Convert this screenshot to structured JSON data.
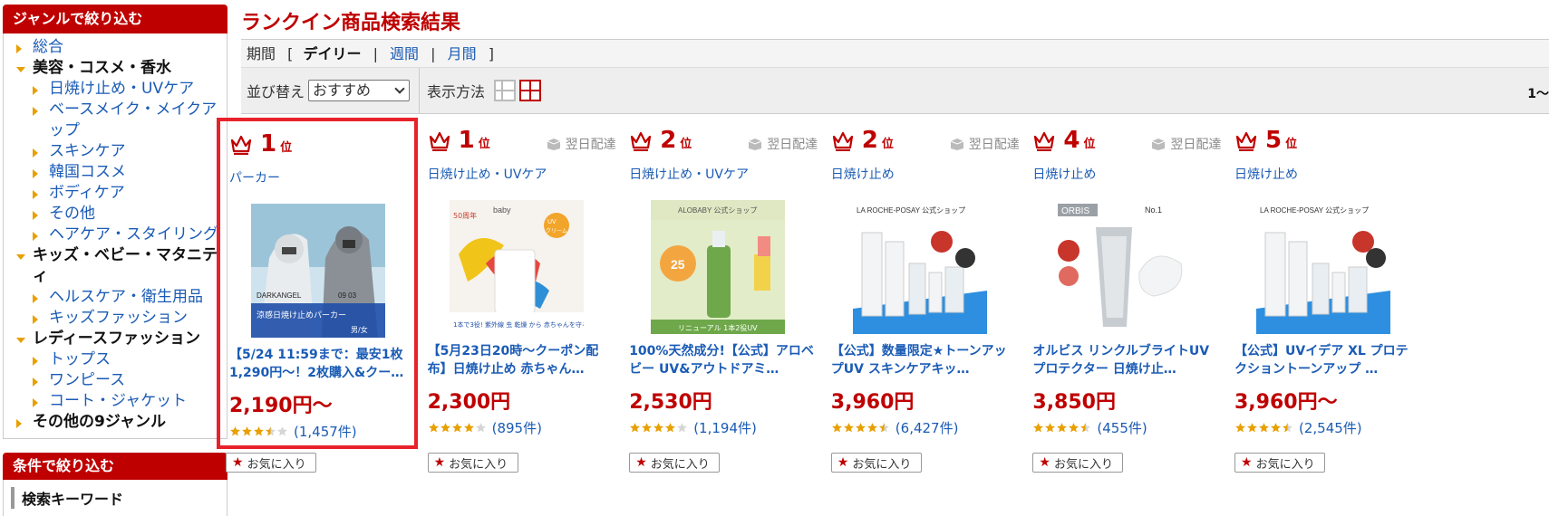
{
  "sidebar": {
    "genre_title": "ジャンルで絞り込む",
    "items": [
      {
        "label": "総合",
        "level": "top",
        "arrow": "right",
        "style": "link"
      },
      {
        "label": "美容・コスメ・香水",
        "level": "top",
        "arrow": "down",
        "style": "bold"
      },
      {
        "label": "日焼け止め・UVケア",
        "level": "sub",
        "arrow": "right",
        "style": "link"
      },
      {
        "label": "ベースメイク・メイクアップ",
        "level": "sub",
        "arrow": "right",
        "style": "link"
      },
      {
        "label": "スキンケア",
        "level": "sub",
        "arrow": "right",
        "style": "link"
      },
      {
        "label": "韓国コスメ",
        "level": "sub",
        "arrow": "right",
        "style": "link"
      },
      {
        "label": "ボディケア",
        "level": "sub",
        "arrow": "right",
        "style": "link"
      },
      {
        "label": "その他",
        "level": "sub",
        "arrow": "right",
        "style": "link"
      },
      {
        "label": "ヘアケア・スタイリング",
        "level": "sub",
        "arrow": "right",
        "style": "link"
      },
      {
        "label": "キッズ・ベビー・マタニティ",
        "level": "top",
        "arrow": "down",
        "style": "bold"
      },
      {
        "label": "ヘルスケア・衛生用品",
        "level": "sub",
        "arrow": "right",
        "style": "link"
      },
      {
        "label": "キッズファッション",
        "level": "sub",
        "arrow": "right",
        "style": "link"
      },
      {
        "label": "レディースファッション",
        "level": "top",
        "arrow": "down",
        "style": "bold"
      },
      {
        "label": "トップス",
        "level": "sub",
        "arrow": "right",
        "style": "link"
      },
      {
        "label": "ワンピース",
        "level": "sub",
        "arrow": "right",
        "style": "link"
      },
      {
        "label": "コート・ジャケット",
        "level": "sub",
        "arrow": "right",
        "style": "link"
      },
      {
        "label": "その他の9ジャンル",
        "level": "top",
        "arrow": "right",
        "style": "bold"
      }
    ],
    "condition_title": "条件で絞り込む",
    "keyword_label": "検索キーワード"
  },
  "main": {
    "title": "ランクイン商品検索結果",
    "period_label": "期間",
    "bracket_open": "[",
    "bracket_close": "]",
    "sep": "|",
    "period_active": "デイリー",
    "period_weekly": "週間",
    "period_monthly": "月間",
    "sort_label": "並び替え",
    "sort_value": "おすすめ",
    "view_label": "表示方法",
    "count_text": "1〜"
  },
  "colors": {
    "accent": "#bf0000",
    "link": "#1a5bb5",
    "star": "#e8a000",
    "highlight": "#e8222b"
  },
  "products": [
    {
      "rank": "1",
      "rank_unit": "位",
      "genre": "パーカー",
      "delivery": "",
      "title": "【5/24 11:59まで：最安1枚1,290円〜！2枚購入&クー…",
      "price": "2,190円〜",
      "rating": 3.5,
      "reviews": "(1,457件)",
      "fav": "お気に入り",
      "image": "parka"
    },
    {
      "rank": "1",
      "rank_unit": "位",
      "genre": "日焼け止め・UVケア",
      "delivery": "翌日配達",
      "title": "【5月23日20時〜クーポン配布】日焼け止め 赤ちゃん…",
      "price": "2,300円",
      "rating": 4.0,
      "reviews": "(895件)",
      "fav": "お気に入り",
      "image": "baby"
    },
    {
      "rank": "2",
      "rank_unit": "位",
      "genre": "日焼け止め・UVケア",
      "delivery": "翌日配達",
      "title": "100%天然成分!【公式】アロベビー UV&アウトドアミ…",
      "price": "2,530円",
      "rating": 4.0,
      "reviews": "(1,194件)",
      "fav": "お気に入り",
      "image": "alobaby"
    },
    {
      "rank": "2",
      "rank_unit": "位",
      "genre": "日焼け止め",
      "delivery": "翌日配達",
      "title": "【公式】数量限定★トーンアップUV スキンケアキッ…",
      "price": "3,960円",
      "rating": 4.5,
      "reviews": "(6,427件)",
      "fav": "お気に入り",
      "image": "laroche"
    },
    {
      "rank": "4",
      "rank_unit": "位",
      "genre": "日焼け止め",
      "delivery": "翌日配達",
      "title": "オルビス リンクルブライトUVプロテクター 日焼け止…",
      "price": "3,850円",
      "rating": 4.5,
      "reviews": "(455件)",
      "fav": "お気に入り",
      "image": "orbis"
    },
    {
      "rank": "5",
      "rank_unit": "位",
      "genre": "日焼け止め",
      "delivery": "",
      "title": "【公式】UVイデア XL プロテクショントーンアップ …",
      "price": "3,960円〜",
      "rating": 4.5,
      "reviews": "(2,545件)",
      "fav": "お気に入り",
      "image": "laroche2"
    }
  ],
  "thumb_text": {
    "parka_brand": "DARKANGEL",
    "parka_date": "09 03",
    "parka_banner": "涼感日焼け止めパーカー",
    "parka_tags": "男/女",
    "baby_brand": "baby",
    "baby_50": "50周年",
    "baby_uv": "UV",
    "baby_cream": "クリーム",
    "baby_banner": "1本で3役! 紫外線 虫 乾燥 から 赤ちゃんを守る",
    "alobaby_brand": "ALOBABY 公式ショップ",
    "alobaby_badge": "25",
    "alobaby_foot": "リニューアル 1本2役UV",
    "laroche_brand": "LA ROCHE-POSAY 公式ショップ",
    "orbis_brand": "ORBIS",
    "orbis_sub": "No.1"
  }
}
